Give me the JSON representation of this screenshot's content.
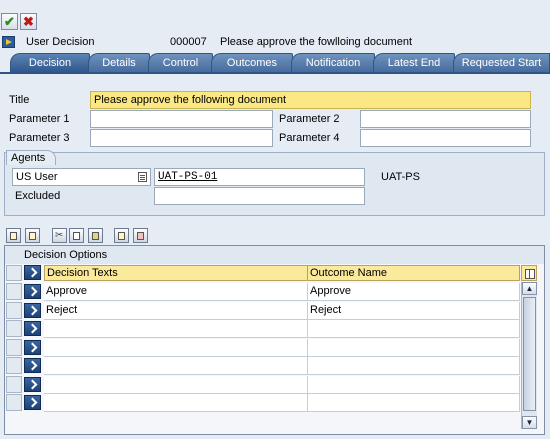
{
  "toolbar": {
    "confirm_icon": "checkmark-icon",
    "cancel_icon": "cancel-x-icon"
  },
  "header": {
    "type": "User Decision",
    "number": "000007",
    "subject": "Please approve the fowlloing document"
  },
  "tabs": [
    "Decision",
    "Details",
    "Control",
    "Outcomes",
    "Notification",
    "Latest End",
    "Requested Start"
  ],
  "active_tab": "Decision",
  "form": {
    "title_label": "Title",
    "title_value": "Please approve the following document",
    "param1_label": "Parameter 1",
    "param2_label": "Parameter 2",
    "param3_label": "Parameter 3",
    "param4_label": "Parameter 4",
    "param1_value": "",
    "param2_value": "",
    "param3_value": "",
    "param4_value": ""
  },
  "agents": {
    "group_title": "Agents",
    "type_value": "US User",
    "agent_value": "UAT-PS-01",
    "agent_desc": "UAT-PS",
    "excluded_label": "Excluded",
    "excluded_value": ""
  },
  "table": {
    "title": "Decision Options",
    "col_texts": "Decision Texts",
    "col_outcome": "Outcome Name",
    "rows": [
      {
        "text": "Approve",
        "outcome": "Approve"
      },
      {
        "text": "Reject",
        "outcome": "Reject"
      },
      {
        "text": "",
        "outcome": ""
      },
      {
        "text": "",
        "outcome": ""
      },
      {
        "text": "",
        "outcome": ""
      },
      {
        "text": "",
        "outcome": ""
      },
      {
        "text": "",
        "outcome": ""
      }
    ]
  },
  "colors": {
    "tab_blue": "#45699a",
    "highlight_yellow": "#fbe884",
    "background": "#e5ecf4"
  }
}
